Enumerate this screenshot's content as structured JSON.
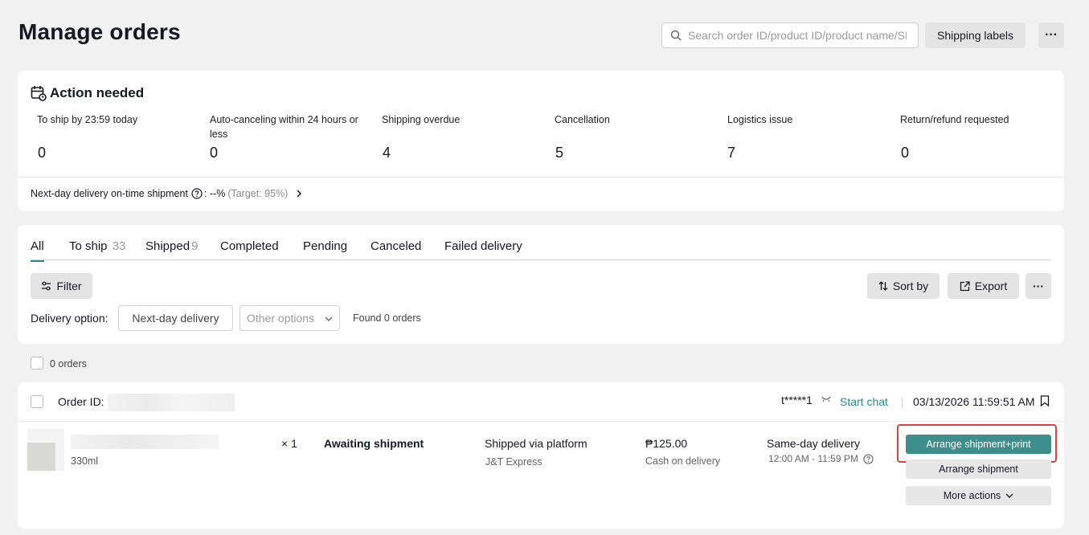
{
  "header": {
    "title": "Manage orders",
    "search_placeholder": "Search order ID/product ID/product name/SKU",
    "shipping_labels": "Shipping labels",
    "more": "···"
  },
  "action_needed": {
    "title": "Action needed",
    "metrics": [
      {
        "label": "To ship by 23:59 today",
        "value": "0"
      },
      {
        "label": "Auto-canceling within 24 hours or less",
        "value": "0"
      },
      {
        "label": "Shipping overdue",
        "value": "4"
      },
      {
        "label": "Cancellation",
        "value": "5"
      },
      {
        "label": "Logistics issue",
        "value": "7"
      },
      {
        "label": "Return/refund requested",
        "value": "0"
      }
    ],
    "ontime_label": "Next-day delivery on-time shipment",
    "ontime_value": ": --%",
    "ontime_target": "(Target: 95%)"
  },
  "orders": {
    "tabs": [
      {
        "label": "All",
        "count": ""
      },
      {
        "label": "To ship",
        "count": "33"
      },
      {
        "label": "Shipped",
        "count": "9"
      },
      {
        "label": "Completed",
        "count": ""
      },
      {
        "label": "Pending",
        "count": ""
      },
      {
        "label": "Canceled",
        "count": ""
      },
      {
        "label": "Failed delivery",
        "count": ""
      }
    ],
    "filter": "Filter",
    "sort_by": "Sort by",
    "export": "Export",
    "more": "···",
    "delivery_option_label": "Delivery option:",
    "next_day": "Next-day delivery",
    "other_options": "Other options",
    "found": "Found 0 orders"
  },
  "selection": {
    "count_label": "0 orders"
  },
  "order": {
    "id_label": "Order ID:",
    "buyer": "t*****1",
    "start_chat": "Start chat",
    "date": "03/13/2026 11:59:51 AM",
    "variant": "330ml",
    "quantity": "× 1",
    "status": "Awaiting shipment",
    "shipped_via": "Shipped via platform",
    "carrier": "J&T Express",
    "price": "₱125.00",
    "payment": "Cash on delivery",
    "delivery_type": "Same-day delivery",
    "delivery_window": "12:00 AM - 11:59 PM",
    "btn_arrange_print": "Arrange shipment+print",
    "btn_arrange": "Arrange shipment",
    "btn_more_actions": "More actions"
  },
  "colors": {
    "accent": "#2a8a8a",
    "primary_button": "#3c8f8c",
    "highlight": "#e04040"
  }
}
